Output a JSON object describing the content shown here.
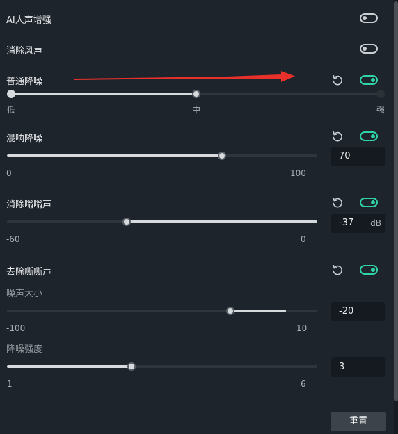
{
  "ai_voice": {
    "label": "AI人声增强",
    "enabled": false
  },
  "wind_removal": {
    "label": "消除风声",
    "enabled": false
  },
  "normal_denoise": {
    "label": "普通降噪",
    "enabled": true,
    "level_labels": [
      "低",
      "中",
      "强"
    ],
    "selected_level": "中"
  },
  "reverb_denoise": {
    "label": "混响降噪",
    "enabled": true,
    "value": "70",
    "min": "0",
    "max": "100"
  },
  "hum_removal": {
    "label": "消除嗡嗡声",
    "enabled": true,
    "value": "-37",
    "unit": "dB",
    "min": "-60",
    "max": "0"
  },
  "hiss_removal": {
    "label": "去除嘶嘶声",
    "enabled": true,
    "noise_volume": {
      "label": "噪声大小",
      "value": "-20",
      "min": "-100",
      "max": "10"
    },
    "denoise_strength": {
      "label": "降噪强度",
      "value": "3",
      "min": "1",
      "max": "6"
    }
  },
  "footer": {
    "reset_label": "重置"
  },
  "colors": {
    "accent": "#2fd3a4",
    "annotation_arrow": "#e8312a",
    "background": "#1e242b"
  }
}
